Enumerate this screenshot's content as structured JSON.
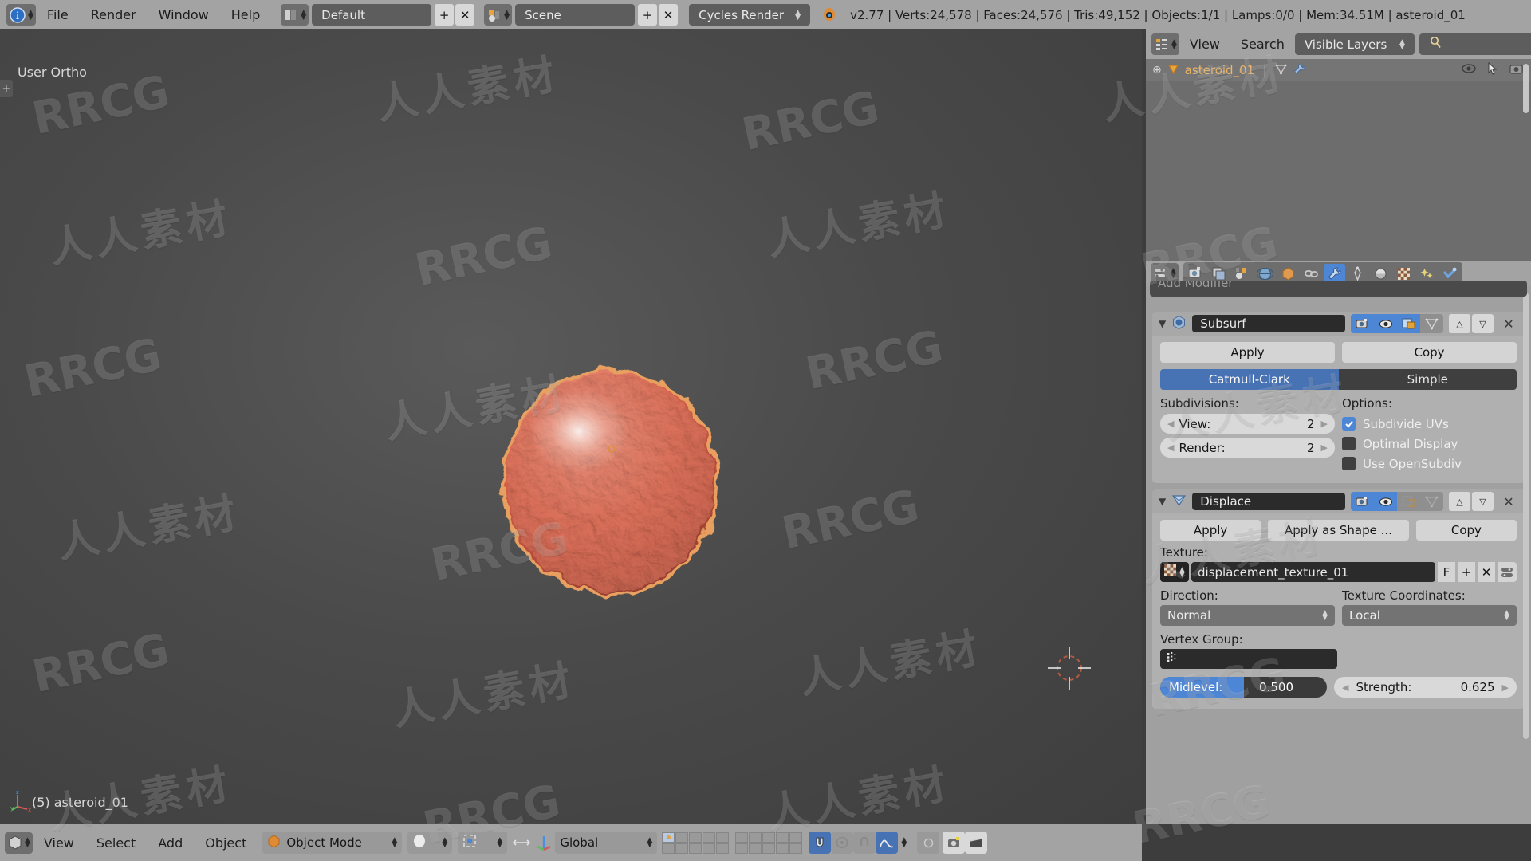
{
  "topbar": {
    "info_icon": "blender-info-icon",
    "menus": [
      "File",
      "Render",
      "Window",
      "Help"
    ],
    "screen_layout": {
      "icon": "screen-layout-icon",
      "value": "Default",
      "add": "+",
      "remove": "✕"
    },
    "scene": {
      "icon": "scene-icon",
      "value": "Scene",
      "add": "+",
      "remove": "✕"
    },
    "render_engine": {
      "value": "Cycles Render",
      "icon": "cycles-icon"
    },
    "stats": "v2.77 | Verts:24,578 | Faces:24,576 | Tris:49,152 | Objects:1/1 | Lamps:0/0 | Mem:34.51M | asteroid_01",
    "stats_parts": {
      "version": "v2.77",
      "verts": "Verts:24,578",
      "faces": "Faces:24,576",
      "tris": "Tris:49,152",
      "objects": "Objects:1/1",
      "lamps": "Lamps:0/0",
      "mem": "Mem:34.51M",
      "active_object": "asteroid_01"
    }
  },
  "viewport": {
    "view_label": "User Ortho",
    "status_object": "(5) asteroid_01",
    "expand_handle": "+",
    "object_color": "#d9654f",
    "outline_color": "#e8a060",
    "background_color": "#4a4a4a",
    "cursor_name": "3d-cursor"
  },
  "viewport_header": {
    "editor_type_icon": "editor-type-3dview-icon",
    "menus": [
      "View",
      "Select",
      "Add",
      "Object"
    ],
    "mode": {
      "label": "Object Mode",
      "icon": "object-mode-icon"
    },
    "shading": {
      "label": "",
      "icon": "shading-solid-icon"
    },
    "pivot": {
      "icon": "pivot-median-point-icon"
    },
    "manipulator": {
      "icon": "manipulator-icon"
    },
    "transform_orientation": "Global",
    "layers_label": "scene-layers",
    "snap_icon": "snap-magnet-icon",
    "proportional_icon": "proportional-edit-icon",
    "render_icon": "render-still-icon",
    "animation_icon": "render-animation-icon"
  },
  "outliner": {
    "editor_type_icon": "editor-type-outliner-icon",
    "menus": [
      "View",
      "Search"
    ],
    "display_mode": "Visible Layers",
    "search_placeholder": "",
    "search_icon": "magnifier-icon",
    "rows": [
      {
        "expand": "⊕",
        "icon": "mesh-object-icon",
        "name": "asteroid_01",
        "data_icons": [
          "mesh-data-icon",
          "modifier-wrench-icon"
        ],
        "restrict_icons": [
          "restrict-view-eye-icon",
          "restrict-select-cursor-icon",
          "restrict-render-camera-icon"
        ]
      }
    ]
  },
  "properties": {
    "editor_type_icon": "editor-type-properties-icon",
    "tabs": [
      {
        "name": "render-tab",
        "icon": "camera-back-icon",
        "selected": false
      },
      {
        "name": "render-layers-tab",
        "icon": "render-layers-icon",
        "selected": false
      },
      {
        "name": "scene-tab",
        "icon": "scene-tab-icon",
        "selected": false
      },
      {
        "name": "world-tab",
        "icon": "world-globe-icon",
        "selected": false
      },
      {
        "name": "object-tab",
        "icon": "object-cube-icon",
        "selected": false
      },
      {
        "name": "constraints-tab",
        "icon": "constraint-chain-icon",
        "selected": false
      },
      {
        "name": "modifiers-tab",
        "icon": "modifier-wrench-icon",
        "selected": true
      },
      {
        "name": "particles-tab",
        "icon": "particles-icon",
        "selected": false
      },
      {
        "name": "physics-tab",
        "icon": "physics-orbit-icon",
        "selected": false
      },
      {
        "name": "object-data-tab",
        "icon": "texture-checker-icon",
        "selected": false
      },
      {
        "name": "material-tab",
        "icon": "material-sparkle-icon",
        "selected": false
      },
      {
        "name": "texture-tab",
        "icon": "texture-checkmark-icon",
        "selected": false
      }
    ],
    "add_modifier": "Add Modifier",
    "modifiers": [
      {
        "id": "subsurf",
        "icon": "modifier-subsurf-icon",
        "name": "Subsurf",
        "collapse_icon": "triangle-down-icon",
        "display_toggles": [
          {
            "name": "render-toggle",
            "icon": "camera-icon",
            "on": true
          },
          {
            "name": "realtime-toggle",
            "icon": "eye-icon",
            "on": true
          },
          {
            "name": "editmode-toggle",
            "icon": "editmode-icon",
            "on": true
          },
          {
            "name": "on-cage-toggle",
            "icon": "cage-triangle-icon",
            "on": false
          }
        ],
        "move_up": "△",
        "move_down": "▽",
        "close": "✕",
        "buttons": [
          "Apply",
          "Copy"
        ],
        "subdivision_type": {
          "options": [
            "Catmull-Clark",
            "Simple"
          ],
          "selected": "Catmull-Clark"
        },
        "subdivisions_label": "Subdivisions:",
        "options_label": "Options:",
        "fields": [
          {
            "label": "View:",
            "value": "2"
          },
          {
            "label": "Render:",
            "value": "2"
          }
        ],
        "checkboxes": [
          {
            "label": "Subdivide UVs",
            "checked": true
          },
          {
            "label": "Optimal Display",
            "checked": false
          },
          {
            "label": "Use OpenSubdiv",
            "checked": false
          }
        ]
      },
      {
        "id": "displace",
        "icon": "modifier-displace-icon",
        "name": "Displace",
        "collapse_icon": "triangle-down-icon",
        "display_toggles": [
          {
            "name": "render-toggle",
            "icon": "camera-icon",
            "on": true
          },
          {
            "name": "realtime-toggle",
            "icon": "eye-icon",
            "on": true
          },
          {
            "name": "editmode-toggle",
            "icon": "editmode-icon",
            "on": false
          },
          {
            "name": "on-cage-toggle",
            "icon": "cage-triangle-icon",
            "on": false
          }
        ],
        "move_up": "△",
        "move_down": "▽",
        "close": "✕",
        "buttons": [
          "Apply",
          "Apply as Shape ...",
          "Copy"
        ],
        "texture_label": "Texture:",
        "texture_name": "displacement_texture_01",
        "texture_icon": "texture-checker-icon",
        "fake_user": "F",
        "texture_new": "+",
        "texture_unlink": "✕",
        "texture_browse": "browse-icon",
        "direction_label": "Direction:",
        "direction_value": "Normal",
        "texcoords_label": "Texture Coordinates:",
        "texcoords_value": "Local",
        "vertex_group_label": "Vertex Group:",
        "vertex_group_value": "",
        "vertex_group_icon": "vertex-group-icon",
        "midlevel_label": "Midlevel:",
        "midlevel_value": "0.500",
        "midlevel_fill_pct": 50,
        "strength_label": "Strength:",
        "strength_value": "0.625"
      }
    ]
  },
  "watermarks": {
    "latin": "RRCG",
    "cjk": "人人素材"
  }
}
